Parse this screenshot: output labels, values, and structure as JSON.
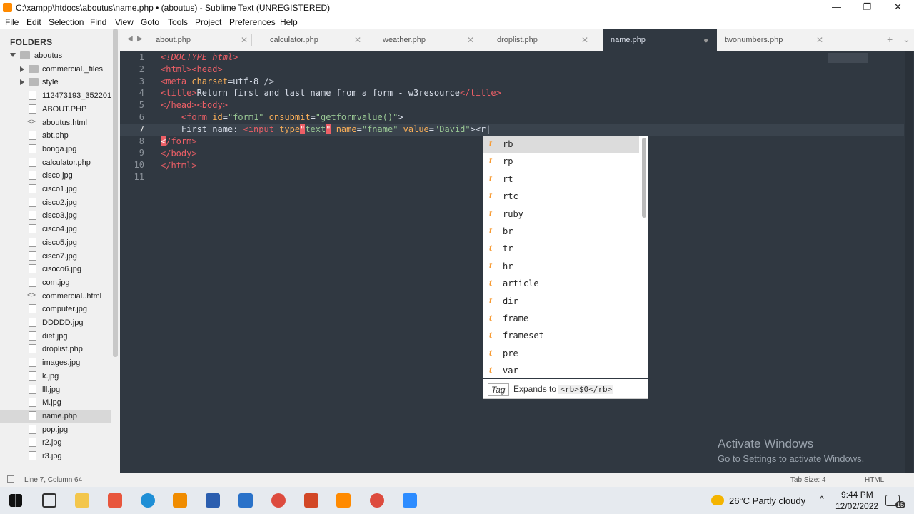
{
  "window": {
    "title": "C:\\xampp\\htdocs\\aboutus\\name.php • (aboutus) - Sublime Text (UNREGISTERED)",
    "minimize": "—",
    "restore": "❐",
    "close": "✕"
  },
  "menu": [
    "File",
    "Edit",
    "Selection",
    "Find",
    "View",
    "Goto",
    "Tools",
    "Project",
    "Preferences",
    "Help"
  ],
  "sidebar": {
    "header": "FOLDERS",
    "root": "aboutus",
    "items": [
      {
        "label": "commercial._files",
        "type": "folder"
      },
      {
        "label": "style",
        "type": "folder"
      },
      {
        "label": "112473193_352201",
        "type": "file"
      },
      {
        "label": "ABOUT.PHP",
        "type": "file"
      },
      {
        "label": "aboutus.html",
        "type": "code"
      },
      {
        "label": "abt.php",
        "type": "file"
      },
      {
        "label": "bonga.jpg",
        "type": "file"
      },
      {
        "label": "calculator.php",
        "type": "file"
      },
      {
        "label": "cisco.jpg",
        "type": "file"
      },
      {
        "label": "cisco1.jpg",
        "type": "file"
      },
      {
        "label": "cisco2.jpg",
        "type": "file"
      },
      {
        "label": "cisco3.jpg",
        "type": "file"
      },
      {
        "label": "cisco4.jpg",
        "type": "file"
      },
      {
        "label": "cisco5.jpg",
        "type": "file"
      },
      {
        "label": "cisco7.jpg",
        "type": "file"
      },
      {
        "label": "cisoco6.jpg",
        "type": "file"
      },
      {
        "label": "com.jpg",
        "type": "file"
      },
      {
        "label": "commercial..html",
        "type": "code"
      },
      {
        "label": "computer.jpg",
        "type": "file"
      },
      {
        "label": "DDDDD.jpg",
        "type": "file"
      },
      {
        "label": "diet.jpg",
        "type": "file"
      },
      {
        "label": "droplist.php",
        "type": "file"
      },
      {
        "label": "images.jpg",
        "type": "file"
      },
      {
        "label": "k.jpg",
        "type": "file"
      },
      {
        "label": "lll.jpg",
        "type": "file"
      },
      {
        "label": "M.jpg",
        "type": "file"
      },
      {
        "label": "name.php",
        "type": "file",
        "selected": true
      },
      {
        "label": "pop.jpg",
        "type": "file"
      },
      {
        "label": "r2.jpg",
        "type": "file"
      },
      {
        "label": "r3.jpg",
        "type": "file"
      }
    ]
  },
  "tabs": [
    {
      "label": "about.php",
      "close": "✕"
    },
    {
      "label": "calculator.php",
      "close": "✕"
    },
    {
      "label": "weather.php",
      "close": "✕"
    },
    {
      "label": "droplist.php",
      "close": "✕"
    },
    {
      "label": "name.php",
      "close": "●",
      "active": true
    },
    {
      "label": "twonumbers.php",
      "close": "✕"
    }
  ],
  "editor": {
    "line_numbers": [
      "1",
      "2",
      "3",
      "4",
      "5",
      "6",
      "7",
      "8",
      "9",
      "10",
      "11"
    ],
    "current_line": 7
  },
  "autocomplete": {
    "kind": "t",
    "items": [
      "rb",
      "rp",
      "rt",
      "rtc",
      "ruby",
      "br",
      "tr",
      "hr",
      "article",
      "dir",
      "frame",
      "frameset",
      "pre",
      "var"
    ],
    "footer_kind": "Tag",
    "footer_text": "Expands to",
    "footer_code": "<rb>$0</rb>"
  },
  "watermark": {
    "line1": "Activate Windows",
    "line2": "Go to Settings to activate Windows."
  },
  "status": {
    "position": "Line 7, Column 64",
    "tab_size": "Tab Size: 4",
    "syntax": "HTML"
  },
  "taskbar": {
    "weather": "26°C  Partly cloudy",
    "time": "9:44 PM",
    "date": "12/02/2022",
    "notif_count": "15"
  }
}
